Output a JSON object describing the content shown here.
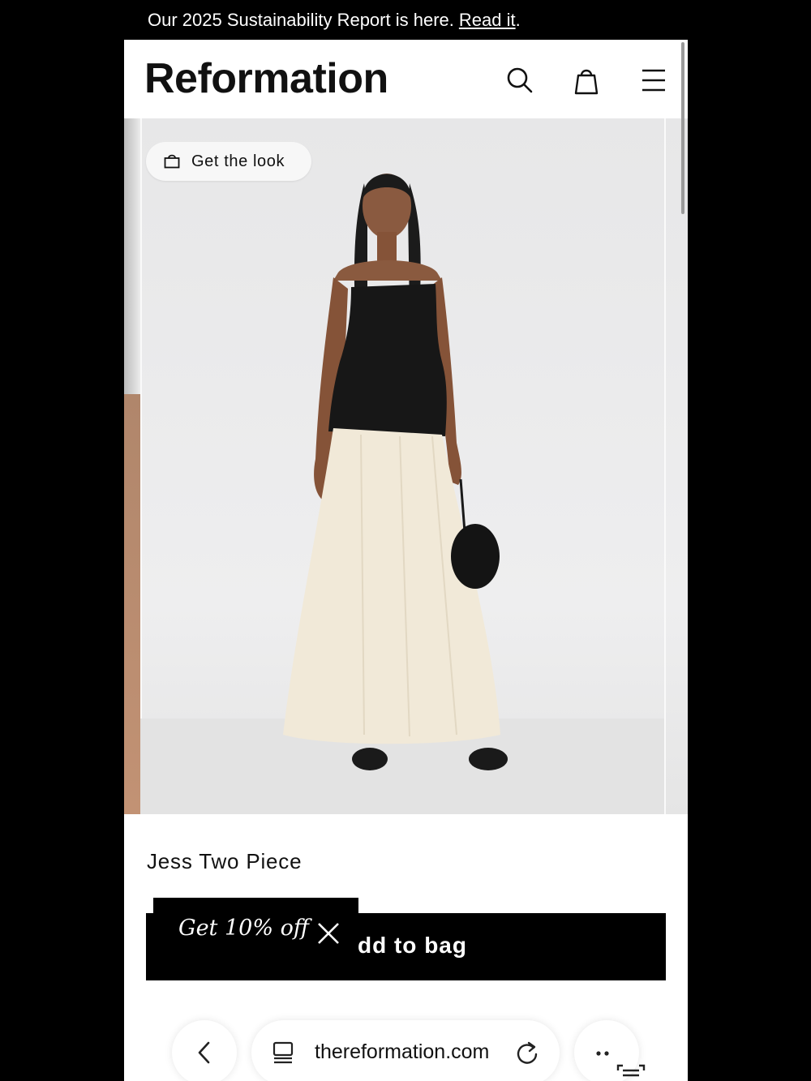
{
  "banner": {
    "text": "Our 2025 Sustainability Report is here.",
    "link": "Read it",
    "period": "."
  },
  "header": {
    "logo": "Reformation",
    "icons": [
      "search-icon",
      "shopping-bag-icon",
      "menu-icon"
    ]
  },
  "hero": {
    "get_the_look": "Get the look"
  },
  "product": {
    "name": "Jess Two Piece",
    "add_to_bag": "dd to bag"
  },
  "promo": {
    "text": "Get 10% off"
  },
  "browser": {
    "url": "thereformation.com"
  },
  "colors": {
    "banner_bg": "#000000",
    "button_bg": "#000000",
    "hero_bg": "#e9e9ea"
  }
}
